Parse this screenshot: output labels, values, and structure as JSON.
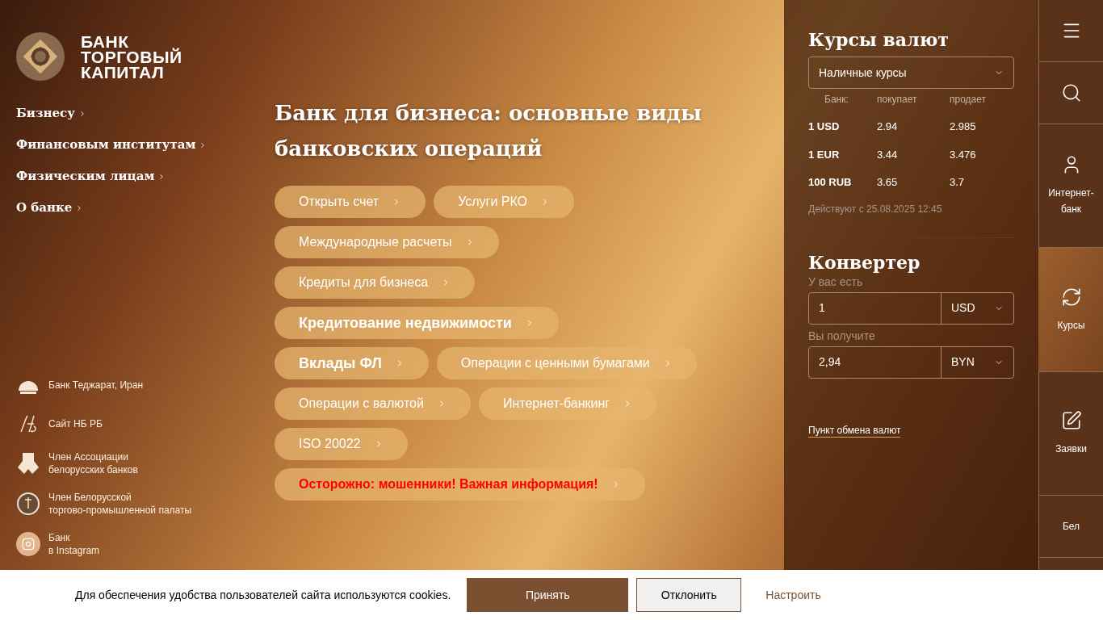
{
  "logo": {
    "lines": [
      "БАНК",
      "ТОРГОВЫЙ",
      "КАПИТАЛ"
    ]
  },
  "nav": [
    "Бизнесу",
    "Финансовым институтам",
    "Физическим лицам",
    "О банке"
  ],
  "partners": [
    {
      "kind": "tejarat",
      "text": "Банк Теджарат, Иран"
    },
    {
      "kind": "nbrb",
      "text": "Сайт НБ РБ"
    },
    {
      "kind": "abb",
      "text": "Член Ассоциации\nбелорусских банков"
    },
    {
      "kind": "chamber",
      "text": "Член Белорусской\nторгово-промышленной палаты"
    },
    {
      "kind": "instagram",
      "text": "Банк\nв Instagram"
    }
  ],
  "hero": {
    "title": "Банк для бизнеса: основные виды банковских операций",
    "button_rows": [
      [
        {
          "label": "Открыть счет",
          "kind": "normal"
        },
        {
          "label": "Услуги РКО",
          "kind": "normal"
        }
      ],
      [
        {
          "label": "Международные расчеты",
          "kind": "normal"
        }
      ],
      [
        {
          "label": "Кредиты для бизнеса",
          "kind": "normal"
        }
      ],
      [
        {
          "label": "Кредитование недвижимости",
          "kind": "large"
        }
      ],
      [
        {
          "label": "Вклады ФЛ",
          "kind": "large"
        },
        {
          "label": "Операции с ценными бумагами",
          "kind": "normal"
        }
      ],
      [
        {
          "label": "Операции с валютой",
          "kind": "normal"
        },
        {
          "label": "Интернет-банкинг",
          "kind": "normal"
        }
      ],
      [
        {
          "label": "ISO 20022",
          "kind": "normal"
        }
      ],
      [
        {
          "label": "Осторожно: мошенники! Важная информация!",
          "kind": "warning"
        }
      ]
    ]
  },
  "rates": {
    "title": "Курсы валют",
    "select": "Наличные курсы",
    "columns": [
      "Банк:",
      "покупает",
      "продает"
    ],
    "rows": [
      [
        "1 USD",
        "2.94",
        "2.985"
      ],
      [
        "1 EUR",
        "3.44",
        "3.476"
      ],
      [
        "100 RUB",
        "3.65",
        "3.7"
      ]
    ],
    "note": "Действуют с 25.08.2025 12:45"
  },
  "converter": {
    "title": "Конвертер",
    "have_label": "У вас есть",
    "have_value": "1",
    "have_currency": "USD",
    "get_label": "Вы получите",
    "get_value": "2,94",
    "get_currency": "BYN",
    "link": "Пункт обмена валют"
  },
  "rail": [
    {
      "kind": "menu",
      "selected": false
    },
    {
      "kind": "search",
      "selected": false
    },
    {
      "kind": "user",
      "label": "Интернет-\nбанк",
      "selected": false
    },
    {
      "kind": "rates",
      "label": "Курсы",
      "selected": true
    },
    {
      "kind": "edit",
      "label": "Заявки",
      "selected": false
    },
    {
      "kind": "lang",
      "label": "Бел",
      "selected": false
    }
  ],
  "cookies": {
    "text": "Для обеспечения удобства пользователей сайта используются cookies.",
    "accept": "Принять",
    "decline": "Отклонить",
    "settings": "Настроить"
  }
}
